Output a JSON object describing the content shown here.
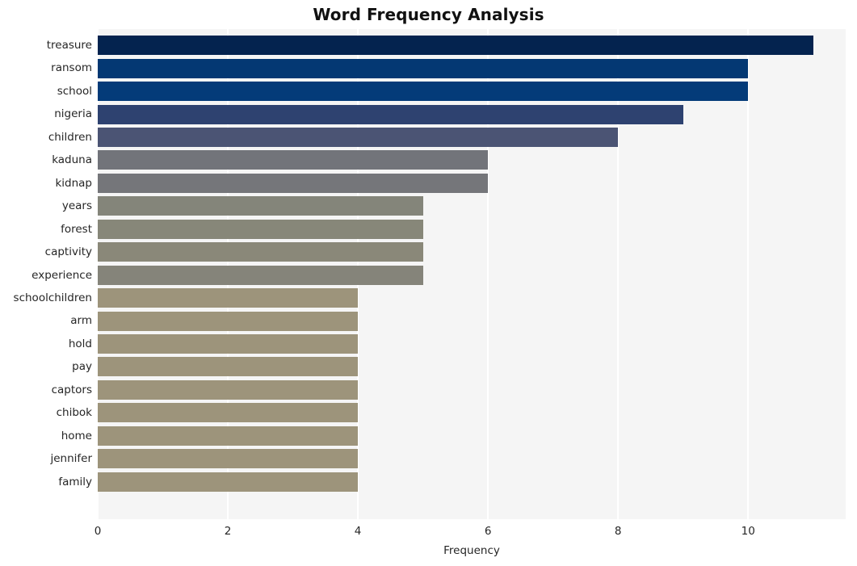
{
  "chart_data": {
    "type": "bar",
    "orientation": "horizontal",
    "title": "Word Frequency Analysis",
    "xlabel": "Frequency",
    "ylabel": "",
    "xlim": [
      0,
      11.5
    ],
    "xticks": [
      0,
      2,
      4,
      6,
      8,
      10
    ],
    "xticklabels": [
      "0",
      "2",
      "4",
      "6",
      "8",
      "10"
    ],
    "grid": true,
    "grid_axis": "x",
    "legend": "none",
    "plot_background": "#f5f5f5",
    "figure_background": "#ffffff",
    "gridline_color": "#ffffff",
    "categories": [
      "treasure",
      "ransom",
      "school",
      "nigeria",
      "children",
      "kaduna",
      "kidnap",
      "years",
      "forest",
      "captivity",
      "experience",
      "schoolchildren",
      "arm",
      "hold",
      "pay",
      "captors",
      "chibok",
      "home",
      "jennifer",
      "family"
    ],
    "values": [
      11,
      10,
      10,
      9,
      8,
      6,
      6,
      5,
      5,
      5,
      5,
      4,
      4,
      4,
      4,
      4,
      4,
      4,
      4,
      4
    ],
    "bar_colors": [
      "#04234f",
      "#043873",
      "#043b79",
      "#2e4270",
      "#4b5474",
      "#72747a",
      "#75767a",
      "#84857a",
      "#878779",
      "#8a8879",
      "#85847a",
      "#9d947b",
      "#9d947b",
      "#9d947b",
      "#9d947b",
      "#9d947b",
      "#9d947b",
      "#9d947b",
      "#9d947b",
      "#9d947b"
    ]
  }
}
